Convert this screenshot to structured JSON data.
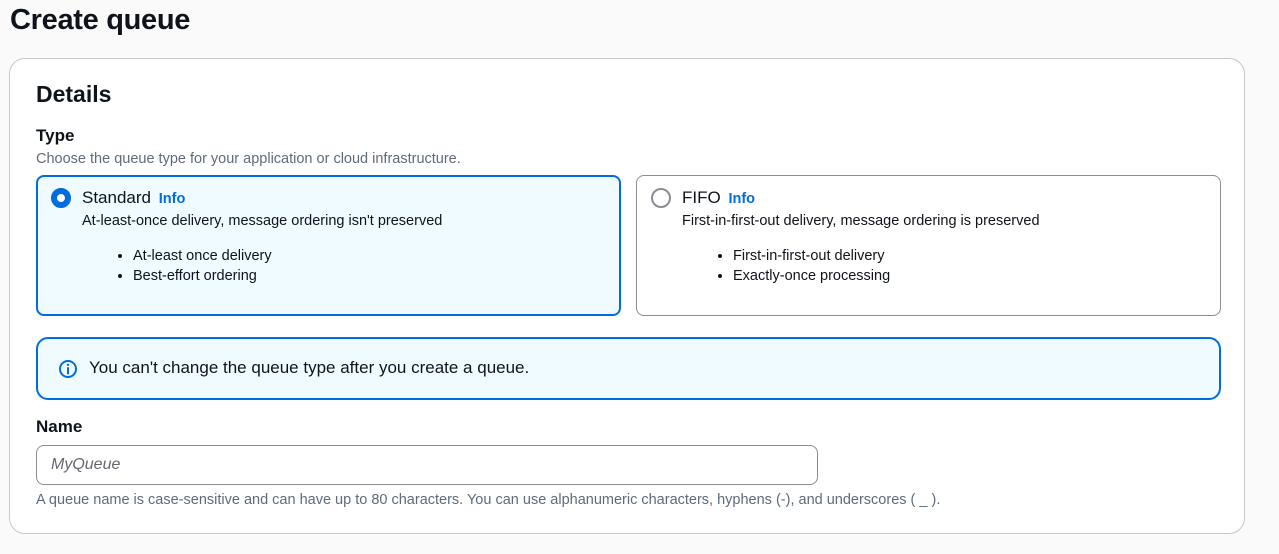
{
  "page": {
    "title": "Create queue"
  },
  "details": {
    "title": "Details",
    "type": {
      "label": "Type",
      "description": "Choose the queue type for your application or cloud infrastructure.",
      "options": [
        {
          "title": "Standard",
          "info": "Info",
          "description": "At-least-once delivery, message ordering isn't preserved",
          "bullets": [
            "At-least once delivery",
            "Best-effort ordering"
          ],
          "selected": true
        },
        {
          "title": "FIFO",
          "info": "Info",
          "description": "First-in-first-out delivery, message ordering is preserved",
          "bullets": [
            "First-in-first-out delivery",
            "Exactly-once processing"
          ],
          "selected": false
        }
      ]
    },
    "alert": {
      "icon": "info-circle-icon",
      "text": "You can't change the queue type after you create a queue."
    },
    "name": {
      "label": "Name",
      "value": "",
      "placeholder": "MyQueue",
      "hint": "A queue name is case-sensitive and can have up to 80 characters. You can use alphanumeric characters, hyphens (-), and underscores ( _ )."
    }
  },
  "colors": {
    "accent": "#006ce0",
    "selected_bg": "#f0fbff",
    "border": "#8c8c94",
    "muted_text": "#5f6b7a"
  }
}
